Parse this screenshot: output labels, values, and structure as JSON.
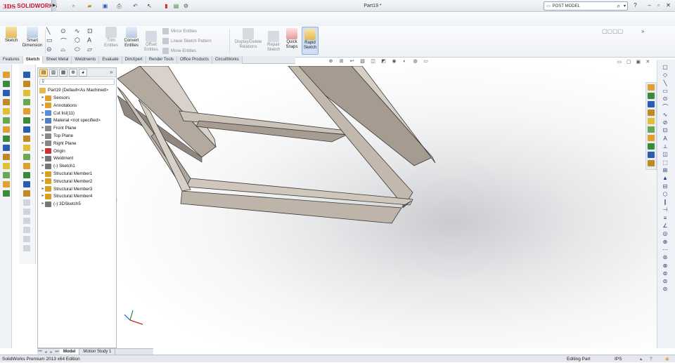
{
  "app": {
    "logo_brand": "SOLIDWORKS",
    "logo_mark": "3DS",
    "document_title": "Part19 *",
    "search_placeholder": "POST MODEL"
  },
  "ribbon": {
    "sketch": "Sketch",
    "smart_dimension": "Smart Dimension",
    "trim_entities": "Trim Entities",
    "convert_entities": "Convert Entities",
    "offset_entities": "Offset Entities",
    "mirror_entities": "Mirror Entities",
    "linear_sketch_pattern": "Linear Sketch Pattern",
    "move_entities": "Move Entities",
    "display_delete_relations": "Display/Delete Relations",
    "repair_sketch": "Repair Sketch",
    "quick_snaps": "Quick Snaps",
    "rapid_sketch": "Rapid Sketch"
  },
  "command_tabs": [
    "Features",
    "Sketch",
    "Sheet Metal",
    "Weldments",
    "Evaluate",
    "DimXpert",
    "Render Tools",
    "Office Products",
    "CircuitWorks"
  ],
  "active_tab": "Sketch",
  "tree": {
    "root": "Part19  (Default<As Machined>",
    "items": [
      {
        "label": "Sensors",
        "icon": "sensor-icon",
        "color": "#e0a030"
      },
      {
        "label": "Annotations",
        "icon": "annotation-icon",
        "color": "#e0a030"
      },
      {
        "label": "Cut list(11)",
        "icon": "cutlist-icon",
        "color": "#5a8fd8"
      },
      {
        "label": "Material <not specified>",
        "icon": "material-icon",
        "color": "#4f7fc0"
      },
      {
        "label": "Front Plane",
        "icon": "plane-icon",
        "color": "#888"
      },
      {
        "label": "Top Plane",
        "icon": "plane-icon",
        "color": "#888"
      },
      {
        "label": "Right Plane",
        "icon": "plane-icon",
        "color": "#888"
      },
      {
        "label": "Origin",
        "icon": "origin-icon",
        "color": "#c33"
      },
      {
        "label": "Weldment",
        "icon": "weldment-icon",
        "color": "#777"
      },
      {
        "label": "(-) Sketch1",
        "icon": "sketch-icon",
        "color": "#777"
      },
      {
        "label": "Structural Member1",
        "icon": "structural-member-icon",
        "color": "#d8a020"
      },
      {
        "label": "Structural Member2",
        "icon": "structural-member-icon",
        "color": "#d8a020"
      },
      {
        "label": "Structural Member3",
        "icon": "structural-member-icon",
        "color": "#d8a020"
      },
      {
        "label": "Structural Member4",
        "icon": "structural-member-icon",
        "color": "#d8a020"
      },
      {
        "label": "(-) 3DSketch5",
        "icon": "sketch3d-icon",
        "color": "#777"
      }
    ]
  },
  "bottom_tabs": [
    "Model",
    "Motion Study 1"
  ],
  "status": {
    "product": "SolidWorks Premium 2013 x64 Edition",
    "mode": "Editing Part",
    "units": "IPS"
  },
  "colors": {
    "brand": "#c8102e",
    "accent": "#2a5db0",
    "active_tab": "#ffffff",
    "part_face": "#c2b8ad",
    "part_edge": "#3a3a3a"
  }
}
